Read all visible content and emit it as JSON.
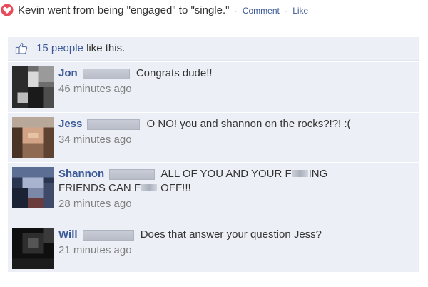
{
  "story": {
    "text": "Kevin went from being \"engaged\" to \"single.\"",
    "comment_label": "Comment",
    "like_label": "Like",
    "separator": "·"
  },
  "likes": {
    "count_label": "15 people",
    "suffix": " like this."
  },
  "comments": [
    {
      "author": "Jon",
      "text": "Congrats dude!!",
      "time": "46 minutes ago"
    },
    {
      "author": "Jess",
      "text": "O NO! you and shannon on the rocks?!?! :(",
      "time": "34 minutes ago"
    },
    {
      "author": "Shannon",
      "text_line1_a": "ALL OF YOU AND YOUR F",
      "text_line1_b": "ING",
      "text_line2_a": "FRIENDS CAN F",
      "text_line2_b": " OFF!!!",
      "time": "28 minutes ago"
    },
    {
      "author": "Will",
      "text": "Does that answer your question Jess?",
      "time": "21 minutes ago"
    }
  ],
  "colors": {
    "link": "#3b5998",
    "panel": "#eceff5",
    "heart": "#e0245e",
    "timestamp": "#808080"
  },
  "icons": {
    "relationship": "heart-icon",
    "like": "thumbs-up-icon"
  }
}
